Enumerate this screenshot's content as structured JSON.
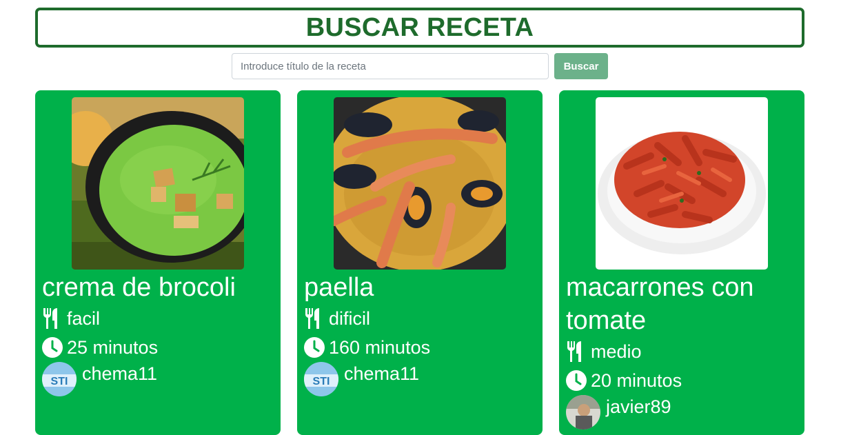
{
  "header": {
    "title": "BUSCAR RECETA"
  },
  "search": {
    "placeholder": "Introduce título de la receta",
    "button_label": "Buscar"
  },
  "recipes": [
    {
      "title": "crema de brocoli",
      "difficulty": "facil",
      "time": "25 minutos",
      "user": "chema11"
    },
    {
      "title": "paella",
      "difficulty": "dificil",
      "time": "160 minutos",
      "user": "chema11"
    },
    {
      "title": "macarrones con tomate",
      "difficulty": "medio",
      "time": "20 minutos",
      "user": "javier89"
    }
  ],
  "colors": {
    "card_bg": "#00b14a",
    "title_green": "#1e6b2c",
    "button_bg": "#6cb18a"
  },
  "icons": [
    "utensils-icon",
    "clock-icon"
  ]
}
